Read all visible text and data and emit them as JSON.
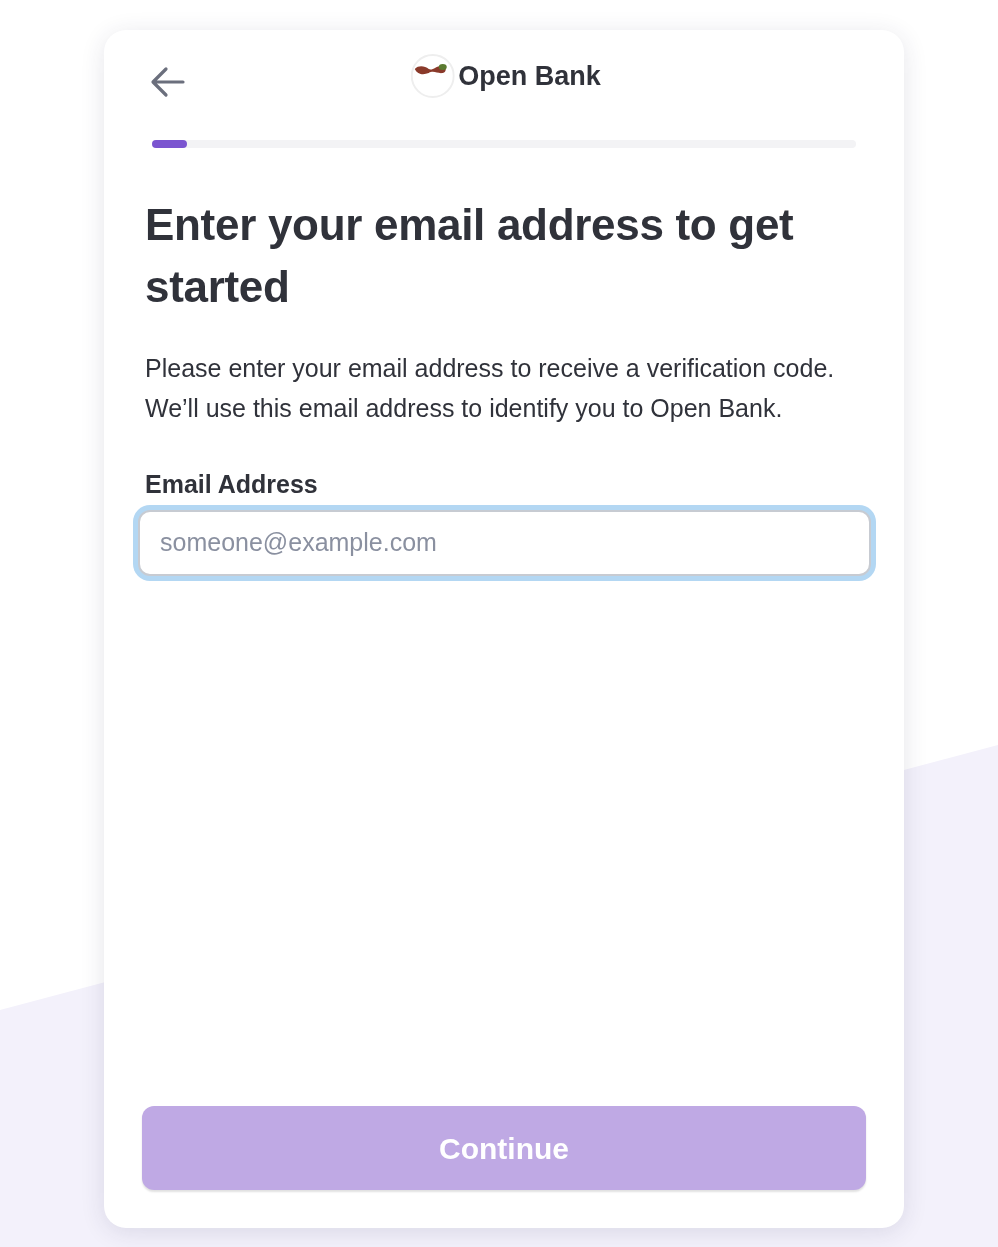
{
  "header": {
    "brand": "Open Bank"
  },
  "progress": {
    "level": 0.05
  },
  "title": "Enter your email address to get started",
  "description": "Please enter your email address to receive a verification code. We’ll use this email address to identify you to Open Bank.",
  "email_field": {
    "label": "Email Address",
    "placeholder": "someone@example.com",
    "focused": true
  },
  "continue_button": {
    "label": "Continue",
    "disabled": true
  }
}
